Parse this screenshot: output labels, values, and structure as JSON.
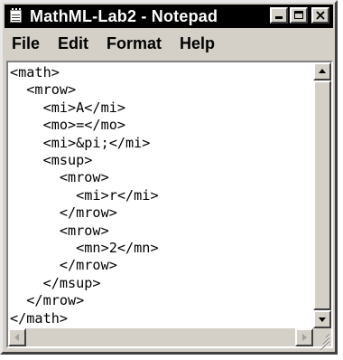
{
  "window": {
    "title": "MathML-Lab2 - Notepad"
  },
  "title_buttons": {
    "minimize": "minimize-icon",
    "maximize": "maximize-icon",
    "close": "close-icon",
    "close_glyph": "×"
  },
  "menu": {
    "items": [
      {
        "label": "File"
      },
      {
        "label": "Edit"
      },
      {
        "label": "Format"
      },
      {
        "label": "Help"
      }
    ]
  },
  "editor": {
    "lines": [
      "<math>",
      "  <mrow>",
      "    <mi>A</mi>",
      "    <mo>=</mo>",
      "    <mi>&pi;</mi>",
      "    <msup>",
      "      <mrow>",
      "        <mi>r</mi>",
      "      </mrow>",
      "      <mrow>",
      "        <mn>2</mn>",
      "      </mrow>",
      "    </msup>",
      "  </mrow>",
      "</math>"
    ]
  },
  "colors": {
    "titlebar": "#000000",
    "chrome": "#d4d0c8",
    "editor_bg": "#ffffff"
  }
}
